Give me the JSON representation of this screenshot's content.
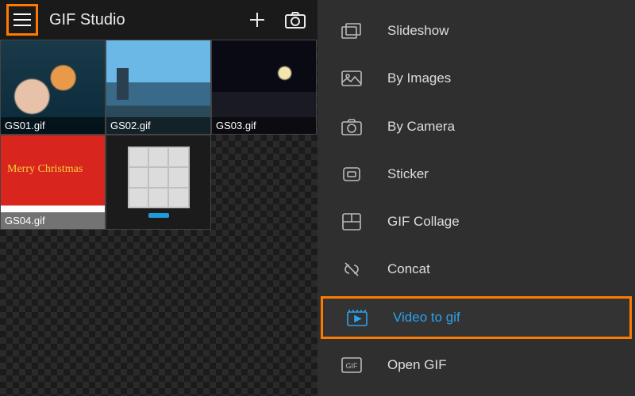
{
  "app": {
    "title": "GIF Studio"
  },
  "thumbs": [
    {
      "file": "GS01.gif",
      "kind": "coral"
    },
    {
      "file": "GS02.gif",
      "kind": "lake"
    },
    {
      "file": "GS03.gif",
      "kind": "night"
    },
    {
      "file": "GS04.gif",
      "kind": "xmas",
      "overlay": "Merry Christmas"
    },
    {
      "file": "",
      "kind": "tiles"
    }
  ],
  "menu": [
    {
      "label": "Slideshow",
      "icon": "slideshow-icon"
    },
    {
      "label": "By Images",
      "icon": "images-icon"
    },
    {
      "label": "By Camera",
      "icon": "camera-icon"
    },
    {
      "label": "Sticker",
      "icon": "sticker-icon"
    },
    {
      "label": "GIF Collage",
      "icon": "collage-icon"
    },
    {
      "label": "Concat",
      "icon": "concat-icon"
    },
    {
      "label": "Video to gif",
      "icon": "video-icon",
      "highlight": true,
      "accent": true
    },
    {
      "label": "Open GIF",
      "icon": "open-icon"
    }
  ],
  "colors": {
    "highlight": "#ff7a00",
    "accent": "#2aa3ef"
  }
}
